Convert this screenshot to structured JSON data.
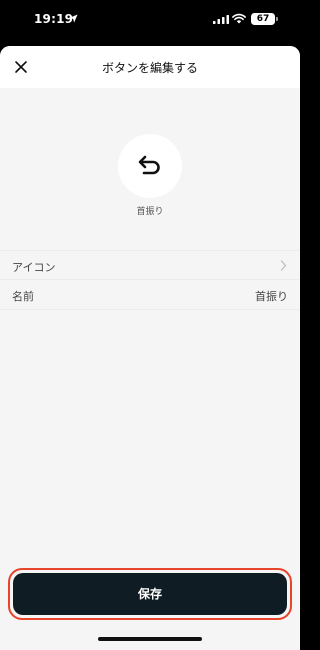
{
  "status_bar": {
    "time": "19:19",
    "battery": "67"
  },
  "header": {
    "title": "ボタンを編集する"
  },
  "preview": {
    "icon_name": "return-arrow-icon",
    "caption": "首振り"
  },
  "rows": {
    "icon_label": "アイコン",
    "name_label": "名前",
    "name_value": "首振り"
  },
  "footer": {
    "save_label": "保存"
  },
  "colors": {
    "save_bg": "#101c24",
    "highlight": "#e8432b",
    "sheet_bg": "#f5f5f5"
  }
}
